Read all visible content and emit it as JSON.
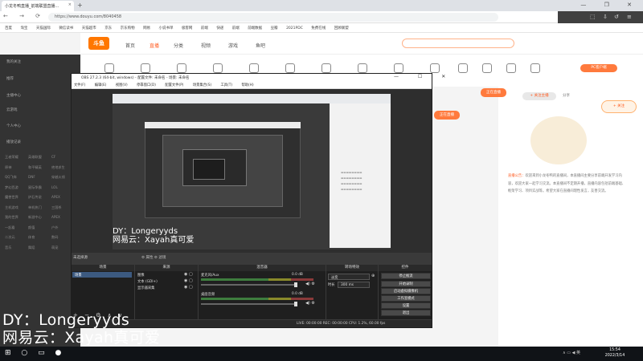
{
  "browser": {
    "tab_title": "小龙冬鸭直播_前端联盟直播...",
    "tab_close": "×",
    "new_tab": "+",
    "window_controls": "— ❐ ✕",
    "url": "https://www.douyu.com/8040458",
    "bookmarks": [
      "百度",
      "淘宝",
      "天猫国际",
      "微信读书",
      "天猫超市",
      "京东",
      "京东购物",
      "网易",
      "小说书单",
      "极客网",
      "前端",
      "快递",
      "前端",
      "前端数据",
      "豆瓣",
      "2021PDC",
      "免费在线",
      "回顾联盟"
    ]
  },
  "douyu": {
    "logo": "斗鱼",
    "nav": [
      "首页",
      "直播",
      "分类",
      "视频",
      "游戏",
      "鱼吧"
    ],
    "sidebar_top": [
      "我的关注",
      "推荐",
      "主播中心",
      "云游戏",
      "个人中心",
      "播放记录"
    ],
    "sidebar_grid": [
      "王者荣耀",
      "英雄联盟",
      "CF",
      "原神",
      "和平精英",
      "绝地求生",
      "QQ飞车",
      "DNF",
      "穿越火线",
      "梦幻西游",
      "星际争霸",
      "LOL",
      "魔兽世界",
      "炉石传说",
      "APEX",
      "主机游戏",
      "单机热门",
      "三国杀",
      "我的世界",
      "新游中心",
      "APEX",
      "一起看",
      "颜值",
      "户外",
      "二次元",
      "体育",
      "数码",
      "音乐",
      "舞蹈",
      "萌宠"
    ],
    "pc_button": "PC客户端",
    "live_badge_1": "正在直播",
    "live_badge_2": "正在直播",
    "follow": "+ 关注主播",
    "share": "分享",
    "plus_badge": "+ 关注",
    "announcement_label": "直播公告：",
    "announcement": "欢迎来到小龙冬鸭的直播间，本直播间主要分享前端开发学习内容，欢迎大家一起学习交流。本直播间不定期开播，直播内容包括前端基础、框架学习、项目实战等。希望大家在直播间理性发言，友善交流。"
  },
  "obs": {
    "title": "OBS 27.2.3 (64-bit, windows) - 配置文件: 未命名 - 场景: 未命名",
    "window_controls": "— ☐ ✕",
    "menu": [
      "文件(F)",
      "编辑(E)",
      "视图(V)",
      "停靠窗口(D)",
      "配置文件(P)",
      "场景集合(S)",
      "工具(T)",
      "帮助(H)"
    ],
    "preview_overlay_line1": "DY：Longeryyds",
    "preview_overlay_line2": "网易云：Xayah真可爱",
    "scene_label": "未选择源",
    "scene_buttons": "⚙ 属性  ⚙ 滤镜",
    "docks": {
      "scenes": "场景",
      "sources": "来源",
      "mixer": "混音器",
      "transitions": "转场特效",
      "controls": "控件"
    },
    "scene_items": [
      "场景"
    ],
    "source_items": [
      "图像",
      "文本 (GDI+)",
      "显示器采集"
    ],
    "mixer_tracks": [
      {
        "name": "麦克风/Aux",
        "db": "0.0 dB"
      },
      {
        "name": "桌面音频",
        "db": "0.0 dB"
      }
    ],
    "transition_value": "淡变",
    "duration_label": "时长",
    "duration_value": "300 ms",
    "controls": [
      "停止推流",
      "开始录制",
      "启动虚拟摄像机",
      "工作室模式",
      "设置",
      "退出"
    ],
    "dock_footer": "+ − ⚙ ∧ ∨",
    "status": "LIVE: 00:00:00    REC: 00:00:00    CPU: 1.2%, 60.00 fps"
  },
  "stream_overlay": {
    "line1": "DY：Longeryyds",
    "line2": "网易云：Xayah真可爱"
  },
  "taskbar": {
    "icons": "⊞ ○ ▭ ●",
    "tray": "∧ ▭ ◀ 英",
    "time": "15:54",
    "date": "2022/3/14"
  }
}
